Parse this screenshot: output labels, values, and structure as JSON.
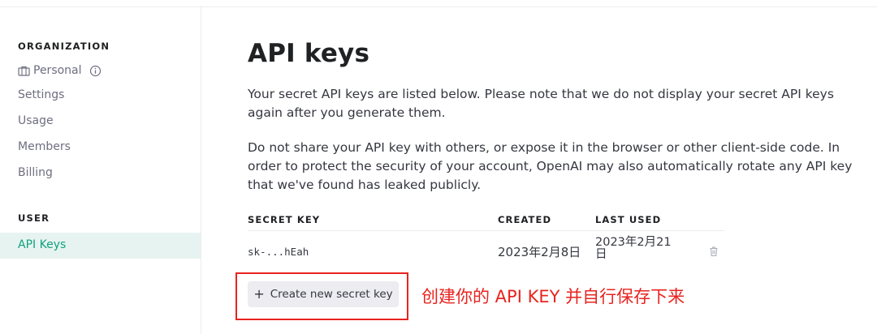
{
  "sidebar": {
    "organization_header": "ORGANIZATION",
    "org_name": "Personal",
    "items": [
      "Settings",
      "Usage",
      "Members",
      "Billing"
    ],
    "user_header": "USER",
    "active_item": "API Keys"
  },
  "main": {
    "title": "API keys",
    "paragraph1": "Your secret API keys are listed below. Please note that we do not display your secret API keys again after you generate them.",
    "paragraph2": "Do not share your API key with others, or expose it in the browser or other client-side code. In order to protect the security of your account, OpenAI may also automatically rotate any API key that we've found has leaked publicly.",
    "table": {
      "headers": [
        "SECRET KEY",
        "CREATED",
        "LAST USED"
      ],
      "rows": [
        {
          "key": "sk-...hEah",
          "created": "2023年2月8日",
          "last_used": "2023年2月21日"
        }
      ]
    },
    "create_button": "Create new secret key"
  },
  "annotation": {
    "text": "创建你的 API KEY 并自行保存下来",
    "color": "#e8231f"
  },
  "colors": {
    "accent": "#10a37f",
    "active_bg": "#e7f3f1"
  }
}
